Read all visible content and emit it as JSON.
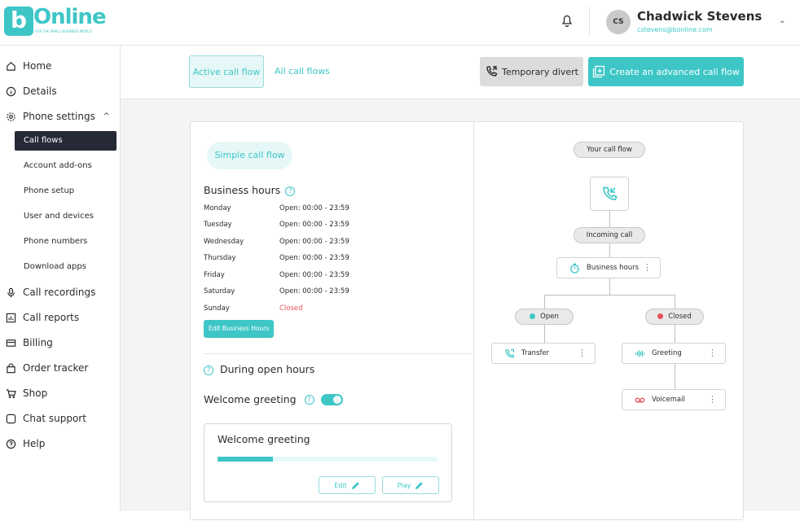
{
  "brand": {
    "name": "Online",
    "mark": "b",
    "tagline": "FOR THE SMALL BUSINESS WORLD"
  },
  "header": {
    "user_initials": "CS",
    "user_name": "Chadwick Stevens",
    "user_email": "cstevens@bonline.com"
  },
  "sidebar": {
    "items": [
      {
        "label": "Home",
        "icon": "home-icon"
      },
      {
        "label": "Details",
        "icon": "info-icon"
      },
      {
        "label": "Phone settings",
        "icon": "gear-icon"
      },
      {
        "label": "Call recordings",
        "icon": "microphone-icon"
      },
      {
        "label": "Call reports",
        "icon": "bar-chart-icon"
      },
      {
        "label": "Billing",
        "icon": "credit-card-icon"
      },
      {
        "label": "Order tracker",
        "icon": "bag-icon"
      },
      {
        "label": "Shop",
        "icon": "cart-icon"
      },
      {
        "label": "Chat support",
        "icon": "chat-icon"
      },
      {
        "label": "Help",
        "icon": "help-icon"
      }
    ],
    "sub_items": [
      {
        "label": "Call flows"
      },
      {
        "label": "Account add-ons"
      },
      {
        "label": "Phone setup"
      },
      {
        "label": "User and devices"
      },
      {
        "label": "Phone numbers"
      },
      {
        "label": "Download apps"
      }
    ]
  },
  "toolbar": {
    "tab_active": "Active call flow",
    "tab_all": "All call flows",
    "divert_label": "Temporary divert",
    "create_label": "Create an advanced call flow"
  },
  "settings": {
    "mode": "Simple call flow",
    "business_hours_title": "Business hours",
    "hours": [
      {
        "day": "Monday",
        "value": "Open: 00:00 - 23:59"
      },
      {
        "day": "Tuesday",
        "value": "Open: 00:00 - 23:59"
      },
      {
        "day": "Wednesday",
        "value": "Open: 00:00 - 23:59"
      },
      {
        "day": "Thursday",
        "value": "Open: 00:00 - 23:59"
      },
      {
        "day": "Friday",
        "value": "Open: 00:00 - 23:59"
      },
      {
        "day": "Saturday",
        "value": "Open: 00:00 - 23:59"
      },
      {
        "day": "Sunday",
        "value": "Closed"
      }
    ],
    "edit_hours_label": "Edit Business Hours",
    "open_hours_title": "During open hours",
    "welcome_greeting_label": "Welcome greeting",
    "welcome_greeting_enabled": true,
    "greeting_box_title": "Welcome greeting",
    "greeting_progress": 0.25,
    "edit_label": "Edit",
    "play_label": "Play"
  },
  "flow": {
    "your_call_flow": "Your call flow",
    "incoming_call": "Incoming call",
    "business_hours": "Business hours",
    "open": "Open",
    "closed": "Closed",
    "transfer": "Transfer",
    "greeting": "Greeting",
    "voicemail": "Voicemail"
  },
  "colors": {
    "accent": "#3ec6c6",
    "sidebar_active": "#262a36",
    "closed_red": "#e8525c"
  }
}
